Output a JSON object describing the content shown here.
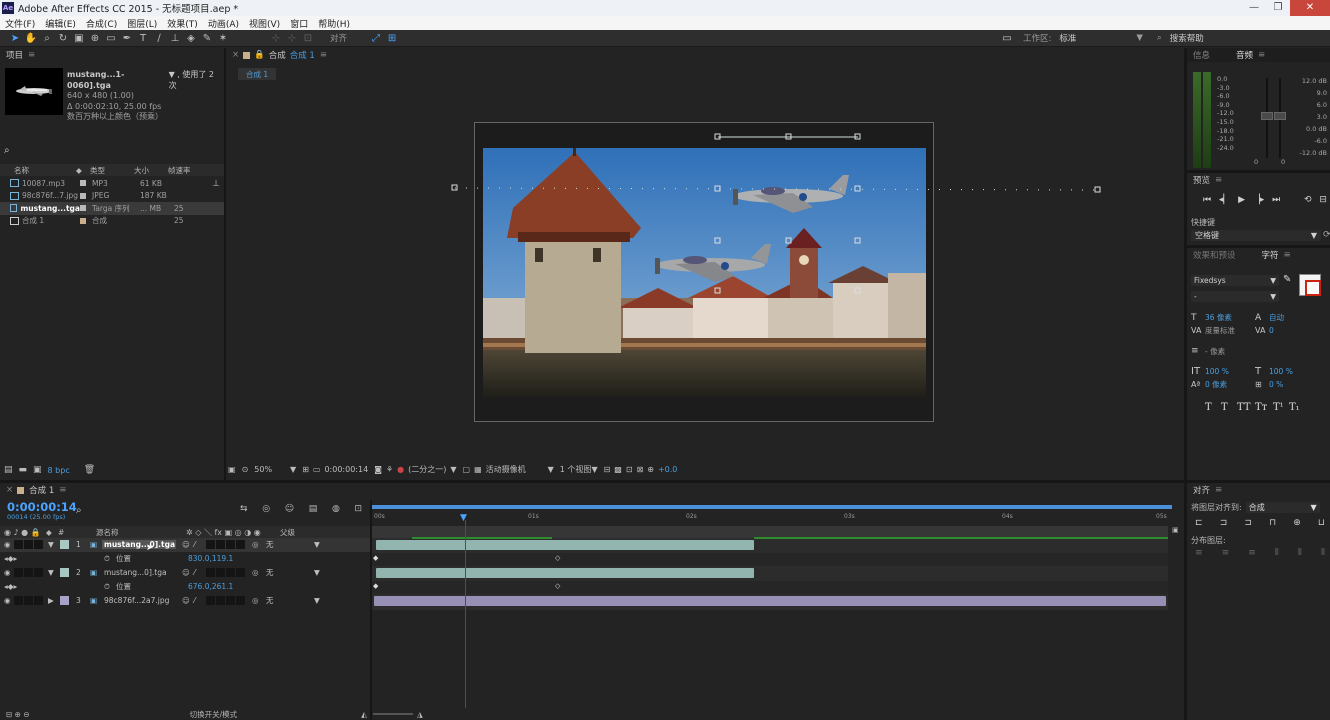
{
  "window": {
    "title": "Adobe After Effects CC 2015 - 无标题项目.aep *",
    "app_icon": "Ae",
    "min": "—",
    "max": "❐",
    "close": "✕"
  },
  "menu": [
    "文件(F)",
    "编辑(E)",
    "合成(C)",
    "图层(L)",
    "效果(T)",
    "动画(A)",
    "视图(V)",
    "窗口",
    "帮助(H)"
  ],
  "toolbar": {
    "align_label": "对齐",
    "workspace_label": "工作区:",
    "workspace_value": "标准",
    "search_help": "搜索帮助"
  },
  "project": {
    "tab": "项目",
    "selected_name": "mustang...1-0060].tga",
    "used": "▼ , 使用了 2 次",
    "dims": "640 x 480 (1.00)",
    "duration": "Δ 0:00:02:10, 25.00 fps",
    "colors": "数百万种以上颜色（预乘）",
    "search_icon": "⌕",
    "columns": [
      "名称",
      "类型",
      "大小",
      "帧速率"
    ],
    "items": [
      {
        "name": "10087.mp3",
        "type": "MP3",
        "size": "61 KB",
        "fps": "",
        "color": "#b9b9b9"
      },
      {
        "name": "98c876f...7.jpg",
        "type": "JPEG",
        "size": "187 KB",
        "fps": "",
        "color": "#b9b9b9"
      },
      {
        "name": "mustang...tga",
        "type": "Targa 序列",
        "size": "... MB",
        "fps": "25",
        "color": "#b9b9b9"
      },
      {
        "name": "合成 1",
        "type": "合成",
        "size": "",
        "fps": "25",
        "color": "#c9b08a"
      }
    ],
    "bpc": "8 bpc"
  },
  "comp_viewer": {
    "tab": "合成",
    "tab_link": "合成 1",
    "breadcrumb": "合成 1",
    "zoom": "50%",
    "timecode": "0:00:00:14",
    "resolution": "(二分之一)",
    "camera": "活动摄像机",
    "views": "1 个视图",
    "exposure": "+0.0"
  },
  "info_panel": {
    "tab_info": "信息",
    "tab_audio": "音频",
    "db_left": [
      "0.0",
      "-3.0",
      "-6.0",
      "-9.0",
      "-12.0",
      "-15.0",
      "-18.0",
      "-21.0",
      "-24.0"
    ],
    "db_right": [
      "12.0 dB",
      "9.0",
      "6.0",
      "3.0",
      "0.0 dB",
      "-6.0",
      "-12.0 dB"
    ],
    "zero1": "0",
    "zero2": "0"
  },
  "preview_panel": {
    "title": "预览",
    "shortcut_label": "快捷键",
    "shortcut_value": "空格键"
  },
  "char_panel": {
    "tab_effects": "效果和预设",
    "tab_char": "字符",
    "font": "Fixedsys",
    "style": "-",
    "size": "36 像素",
    "leading": "自动",
    "kerning": "度量标准",
    "tracking": "0",
    "stroke": "- 像素",
    "vscale": "100 %",
    "hscale": "100 %",
    "baseline": "0 像素",
    "tsume": "0 %",
    "styles": [
      "T",
      "T",
      "TT",
      "Tт",
      "T¹",
      "T₁"
    ]
  },
  "align_panel": {
    "title": "对齐",
    "align_to_label": "将图层对齐到:",
    "align_to_value": "合成",
    "distribute_label": "分布图层:"
  },
  "timeline": {
    "tab": "合成 1",
    "timecode": "0:00:00:14",
    "fps_info": "00014 (25.00 fps)",
    "columns": {
      "num": "#",
      "source": "源名称",
      "parent": "父级"
    },
    "ruler": [
      "00s",
      "01s",
      "02s",
      "03s",
      "04s",
      "05s"
    ],
    "layers": [
      {
        "num": "1",
        "name": "mustang...0].tga",
        "parent": "无",
        "prop": "位置",
        "value": "830.0,119.1",
        "color": "#a9c8c4"
      },
      {
        "num": "2",
        "name": "mustang...0].tga",
        "parent": "无",
        "prop": "位置",
        "value": "676.0,261.1",
        "color": "#a9c8c4"
      },
      {
        "num": "3",
        "name": "98c876f...2a7.jpg",
        "parent": "无",
        "color": "#a8a2c9"
      }
    ],
    "footer": "切换开关/模式"
  },
  "colors": {
    "accent": "#4a9fe0",
    "playhead": "#9b2f2f",
    "workarea": "#2e8b2e",
    "layer_bar": "#93b5b0",
    "image_bar": "#9890b4"
  }
}
